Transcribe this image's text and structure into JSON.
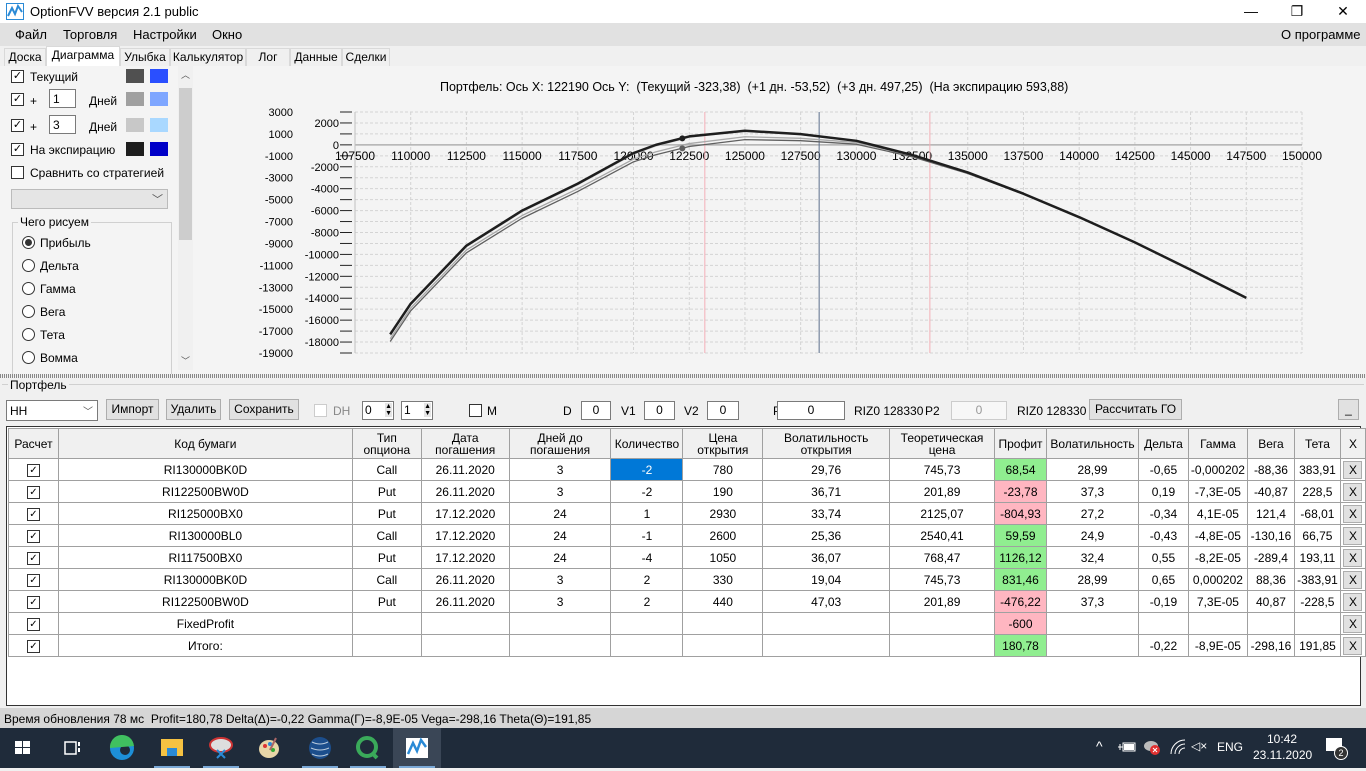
{
  "window": {
    "title": "OptionFVV версия 2.1 public",
    "minimize": "—",
    "maximize": "❐",
    "close": "✕"
  },
  "menu": [
    "Файл",
    "Торговля",
    "Настройки",
    "Окно"
  ],
  "menu_right": "О программе",
  "tabs": [
    {
      "label": "Доска"
    },
    {
      "label": "Диаграмма",
      "active": true
    },
    {
      "label": "Улыбка"
    },
    {
      "label": "Калькулятор"
    },
    {
      "label": "Лог"
    },
    {
      "label": "Данные"
    },
    {
      "label": "Сделки"
    }
  ],
  "left_panel": {
    "current": {
      "label": "Текущий",
      "checked": true,
      "color1": "#505050",
      "color2": "#2a4fff"
    },
    "day1": {
      "plus": "+",
      "value": "1",
      "unit": "Дней",
      "checked": true,
      "color1": "#a0a0a0",
      "color2": "#7ea6ff"
    },
    "day3": {
      "plus": "+",
      "value": "3",
      "unit": "Дней",
      "checked": true,
      "color1": "#c8c8c8",
      "color2": "#a9d8ff"
    },
    "expiration": {
      "label": "На экспирацию",
      "checked": true,
      "color1": "#1e1e1e",
      "color2": "#0000c8"
    },
    "compare": {
      "label": "Сравнить со стратегией",
      "checked": false
    },
    "strategy_select": "",
    "draw_group": {
      "title": "Чего рисуем",
      "options": [
        "Прибыль",
        "Дельта",
        "Гамма",
        "Вега",
        "Тета",
        "Вомма"
      ],
      "selected": "Прибыль"
    }
  },
  "chart_header": "Портфель: Ось X: 122190 Ось Y:  (Текущий -323,38)  (+1 дн. -53,52)  (+3 дн. 497,25)  (На экспирацию 593,88)",
  "chart_data": {
    "type": "line",
    "title": "",
    "xlim": [
      107500,
      150000
    ],
    "ylim": [
      -19000,
      3000
    ],
    "x_ticks": [
      "107500",
      "110000",
      "112500",
      "115000",
      "117500",
      "120000",
      "122500",
      "125000",
      "127500",
      "130000",
      "132500",
      "135000",
      "137500",
      "140000",
      "142500",
      "145000",
      "147500",
      "150000"
    ],
    "y_ticks_outer": [
      "3000",
      "1000",
      "-1000",
      "-3000",
      "-5000",
      "-7000",
      "-9000",
      "-11000",
      "-13000",
      "-15000",
      "-17000",
      "-19000"
    ],
    "y_ticks_inner": [
      "2000",
      "0",
      "-2000",
      "-4000",
      "-6000",
      "-8000",
      "-10000",
      "-12000",
      "-14000",
      "-16000",
      "-18000"
    ],
    "grid": true,
    "x": [
      109080,
      110000,
      112500,
      115000,
      117500,
      120000,
      121000,
      122500,
      125000,
      127500,
      130000,
      132500,
      135000,
      137500,
      140000,
      142500,
      145000,
      147500
    ],
    "series": [
      {
        "key": "current",
        "color": "#606060",
        "values": [
          -17950,
          -15150,
          -9850,
          -6700,
          -4250,
          -1550,
          -900,
          -150,
          480,
          380,
          60,
          -1080,
          -2620,
          -4510,
          -6620,
          -8900,
          -11400,
          -13970
        ]
      },
      {
        "key": "day1",
        "color": "#a8a8a8",
        "values": [
          -17700,
          -14900,
          -9600,
          -6450,
          -4000,
          -1300,
          -640,
          120,
          740,
          600,
          220,
          -980,
          -2570,
          -4490,
          -6610,
          -8900,
          -11400,
          -13970
        ]
      },
      {
        "key": "day3",
        "color": "#c8c8c8",
        "values": [
          -17400,
          -14600,
          -9300,
          -6100,
          -3650,
          -850,
          -100,
          700,
          1240,
          940,
          350,
          -930,
          -2530,
          -4465,
          -6600,
          -8900,
          -11400,
          -13970
        ]
      },
      {
        "key": "expiration",
        "color": "#1e1e1e",
        "values": [
          -17290,
          -14500,
          -9200,
          -6000,
          -3540,
          -750,
          0,
          770,
          1290,
          985,
          370,
          -920,
          -2520,
          -4460,
          -6600,
          -8900,
          -11400,
          -13970
        ]
      }
    ],
    "markers": [
      {
        "x": 122190,
        "y": 593.88,
        "color": "#1e1e1e"
      },
      {
        "x": 122190,
        "y": -323.38,
        "color": "#606060"
      }
    ],
    "vlines": [
      {
        "x": 123200,
        "color": "#f4b0b8"
      },
      {
        "x": 128330,
        "color": "#5b6e8c"
      },
      {
        "x": 133300,
        "color": "#f4b0b8"
      }
    ]
  },
  "portfolio": {
    "title": "Портфель",
    "select": "HH",
    "import": "Импорт",
    "delete": "Удалить",
    "save": "Сохранить",
    "dh": "DH",
    "spin1": "0",
    "spin2": "1",
    "m": "M",
    "d_label": "D",
    "d": "0",
    "v1_label": "V1",
    "v1": "0",
    "v2_label": "V2",
    "v2": "0",
    "p1_label": "P1",
    "p1": "0",
    "riz1": "RIZ0 128330",
    "p2_label": "P2",
    "p2": "0",
    "riz2": "RIZ0 128330",
    "calc_go": "Рассчитать ГО",
    "minimize": "_"
  },
  "table": {
    "headers": [
      "Расчет",
      "Код бумаги",
      "Тип опциона",
      "Дата погашения",
      "Дней до погашения",
      "Количество",
      "Цена открытия",
      "Волатильность открытия",
      "Теоретическая цена",
      "Профит",
      "Волатильность",
      "Дельта",
      "Гамма",
      "Вега",
      "Тета",
      "X"
    ],
    "rows": [
      [
        "✓",
        "RI130000BK0D",
        "Call",
        "26.11.2020",
        "3",
        "-2",
        "780",
        "29,76",
        "745,73",
        "68,54",
        "28,99",
        "-0,65",
        "-0,000202",
        "-88,36",
        "383,91",
        "X"
      ],
      [
        "✓",
        "RI122500BW0D",
        "Put",
        "26.11.2020",
        "3",
        "-2",
        "190",
        "36,71",
        "201,89",
        "-23,78",
        "37,3",
        "0,19",
        "-7,3E-05",
        "-40,87",
        "228,5",
        "X"
      ],
      [
        "✓",
        "RI125000BX0",
        "Put",
        "17.12.2020",
        "24",
        "1",
        "2930",
        "33,74",
        "2125,07",
        "-804,93",
        "27,2",
        "-0,34",
        "4,1E-05",
        "121,4",
        "-68,01",
        "X"
      ],
      [
        "✓",
        "RI130000BL0",
        "Call",
        "17.12.2020",
        "24",
        "-1",
        "2600",
        "25,36",
        "2540,41",
        "59,59",
        "24,9",
        "-0,43",
        "-4,8E-05",
        "-130,16",
        "66,75",
        "X"
      ],
      [
        "✓",
        "RI117500BX0",
        "Put",
        "17.12.2020",
        "24",
        "-4",
        "1050",
        "36,07",
        "768,47",
        "1126,12",
        "32,4",
        "0,55",
        "-8,2E-05",
        "-289,4",
        "193,11",
        "X"
      ],
      [
        "✓",
        "RI130000BK0D",
        "Call",
        "26.11.2020",
        "3",
        "2",
        "330",
        "19,04",
        "745,73",
        "831,46",
        "28,99",
        "0,65",
        "0,000202",
        "88,36",
        "-383,91",
        "X"
      ],
      [
        "✓",
        "RI122500BW0D",
        "Put",
        "26.11.2020",
        "3",
        "2",
        "440",
        "47,03",
        "201,89",
        "-476,22",
        "37,3",
        "-0,19",
        "7,3E-05",
        "40,87",
        "-228,5",
        "X"
      ],
      [
        "✓",
        "FixedProfit",
        "",
        "",
        "",
        "",
        "",
        "",
        "",
        "-600",
        "",
        "",
        "",
        "",
        "",
        "X"
      ],
      [
        "✓",
        "Итого:",
        "",
        "",
        "",
        "",
        "",
        "",
        "",
        "180,78",
        "",
        "-0,22",
        "-8,9E-05",
        "-298,16",
        "191,85",
        "X"
      ]
    ],
    "selected_cell": {
      "row": 0,
      "col": 5,
      "color": "#0078d7"
    },
    "profit_colors": {
      "positive": "#90ee90",
      "negative": "#ffb6c1"
    }
  },
  "status": "Время обновления 78 мс  Profit=180,78 Delta(Δ)=-0,22 Gamma(Γ)=-8,9E-05 Vega=-298,16 Theta(Θ)=191,85",
  "taskbar": {
    "apps": [
      "start-icon",
      "task-view-icon",
      "edge-icon",
      "file-explorer-icon",
      "snipping-tool-icon",
      "paint-icon",
      "browser-icon",
      "qlik-icon",
      "optionfvv-icon"
    ],
    "lang": "ENG",
    "time": "10:42",
    "date": "23.11.2020",
    "notifications": "2",
    "tray_arrow": "^"
  }
}
